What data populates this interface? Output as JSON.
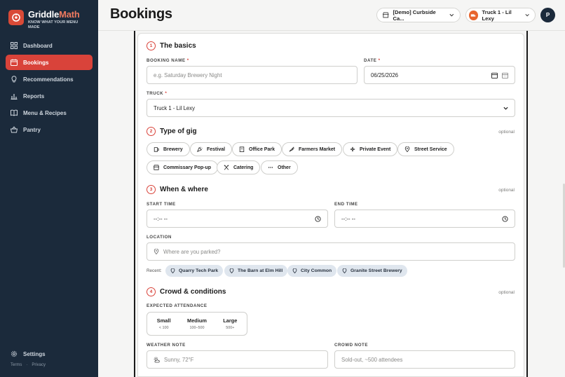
{
  "brand": {
    "name_part1": "Griddle",
    "name_part2": "Math",
    "tagline": "KNOW WHAT YOUR MENU MADE",
    "accent_color": "#d9433a"
  },
  "sidebar": {
    "items": [
      {
        "label": "Dashboard",
        "icon": "grid-icon"
      },
      {
        "label": "Bookings",
        "icon": "calendar-icon",
        "active": true
      },
      {
        "label": "Recommendations",
        "icon": "lightbulb-icon"
      },
      {
        "label": "Reports",
        "icon": "bar-chart-icon"
      },
      {
        "label": "Menu & Recipes",
        "icon": "book-icon"
      },
      {
        "label": "Pantry",
        "icon": "basket-icon"
      }
    ],
    "settings_label": "Settings",
    "footer": {
      "terms": "Terms",
      "separator": "·",
      "privacy": "Privacy"
    }
  },
  "header": {
    "title": "Bookings",
    "location_selector": "[Demo] Curbside Ca...",
    "truck_selector": "Truck 1 - Lil Lexy",
    "user_initial": "P"
  },
  "form": {
    "basics": {
      "step": "1",
      "title": "The basics",
      "booking_name_label": "BOOKING NAME",
      "booking_name_placeholder": "e.g. Saturday Brewery Night",
      "date_label": "DATE",
      "date_value": "06/25/2026",
      "truck_label": "TRUCK",
      "truck_value": "Truck 1 - Lil Lexy",
      "required_mark": "*"
    },
    "gig": {
      "step": "2",
      "title": "Type of gig",
      "optional": "optional",
      "types": [
        "Brewery",
        "Festival",
        "Office Park",
        "Farmers Market",
        "Private Event",
        "Street Service",
        "Commissary Pop-up",
        "Catering",
        "Other"
      ]
    },
    "when_where": {
      "step": "3",
      "title": "When & where",
      "optional": "optional",
      "start_label": "START TIME",
      "start_value": "--:-- --",
      "end_label": "END TIME",
      "end_value": "--:-- --",
      "location_label": "LOCATION",
      "location_placeholder": "Where are you parked?",
      "recent_label": "Recent:",
      "recent": [
        "Quarry Tech Park",
        "The Barn at Elm Hill",
        "City Common",
        "Granite Street Brewery"
      ]
    },
    "crowd": {
      "step": "4",
      "title": "Crowd & conditions",
      "optional": "optional",
      "attendance_label": "EXPECTED ATTENDANCE",
      "options": [
        {
          "label": "Small",
          "range": "< 100"
        },
        {
          "label": "Medium",
          "range": "100–500"
        },
        {
          "label": "Large",
          "range": "500+"
        }
      ],
      "weather_label": "WEATHER NOTE",
      "weather_placeholder": "Sunny, 72°F",
      "crowd_label": "CROWD NOTE",
      "crowd_placeholder": "Sold-out, ~500 attendees"
    }
  }
}
